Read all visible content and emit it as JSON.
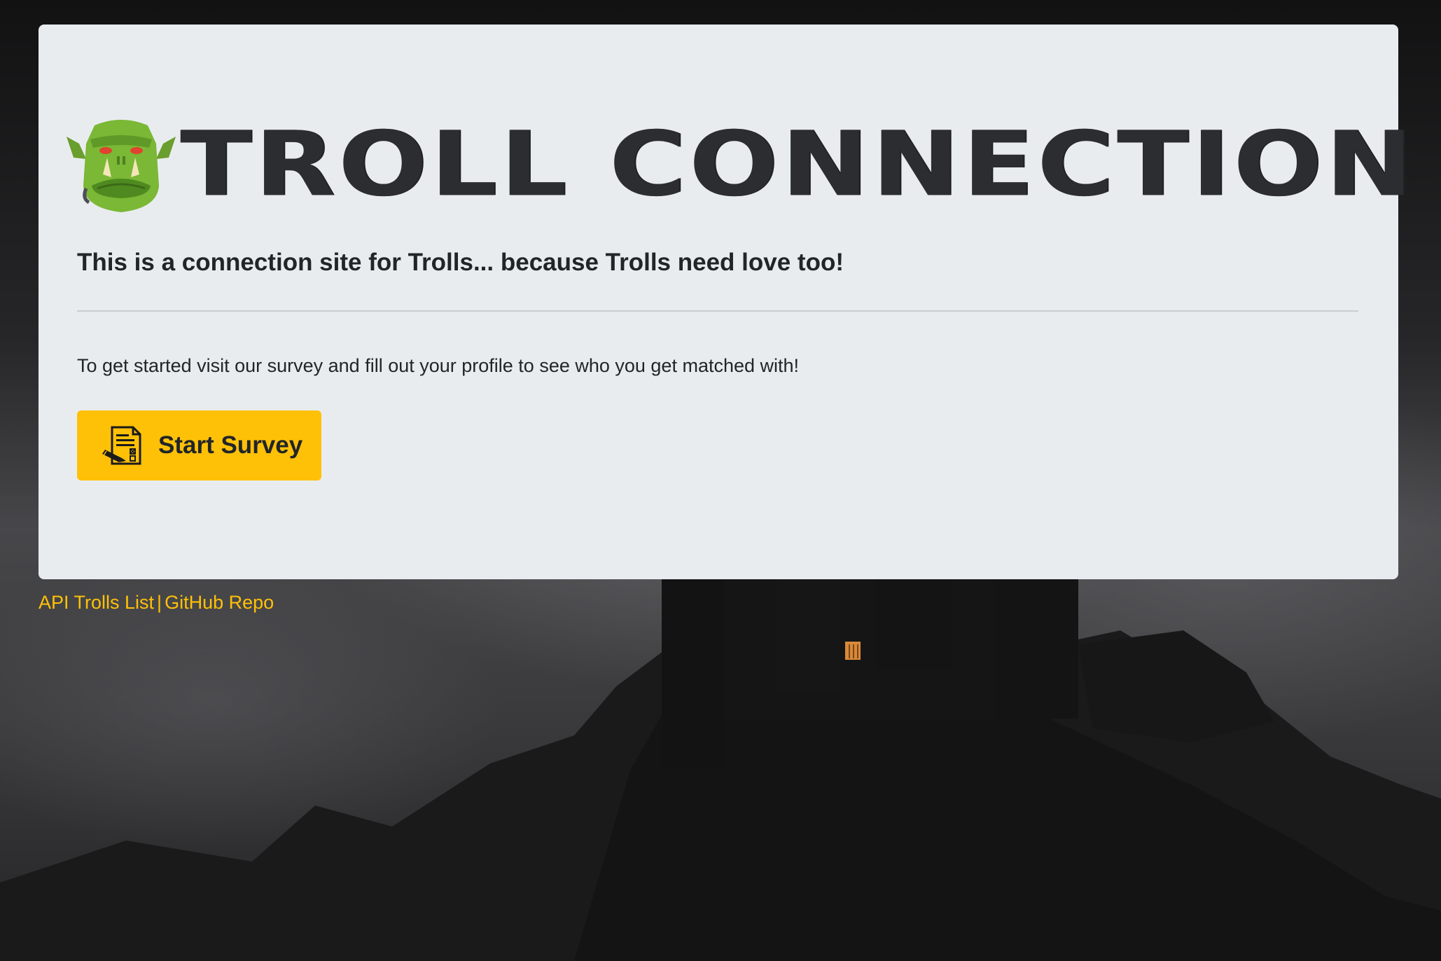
{
  "header": {
    "logo_icon": "ogre-icon",
    "title": "TROLL CONNECTION"
  },
  "jumbotron": {
    "lead": "This is a connection site for Trolls... because Trolls need love too!",
    "text": "To get started visit our survey and fill out your profile to see who you get matched with!",
    "button": {
      "icon": "survey-form-icon",
      "label": "Start Survey"
    }
  },
  "footer": {
    "links": [
      {
        "label": "API Trolls List"
      },
      {
        "label": "GitHub Repo"
      }
    ],
    "separator": "|"
  },
  "colors": {
    "card_bg": "#e9ecef",
    "accent": "#ffc107",
    "text": "#212529",
    "page_bg": "#2b2b2d"
  }
}
